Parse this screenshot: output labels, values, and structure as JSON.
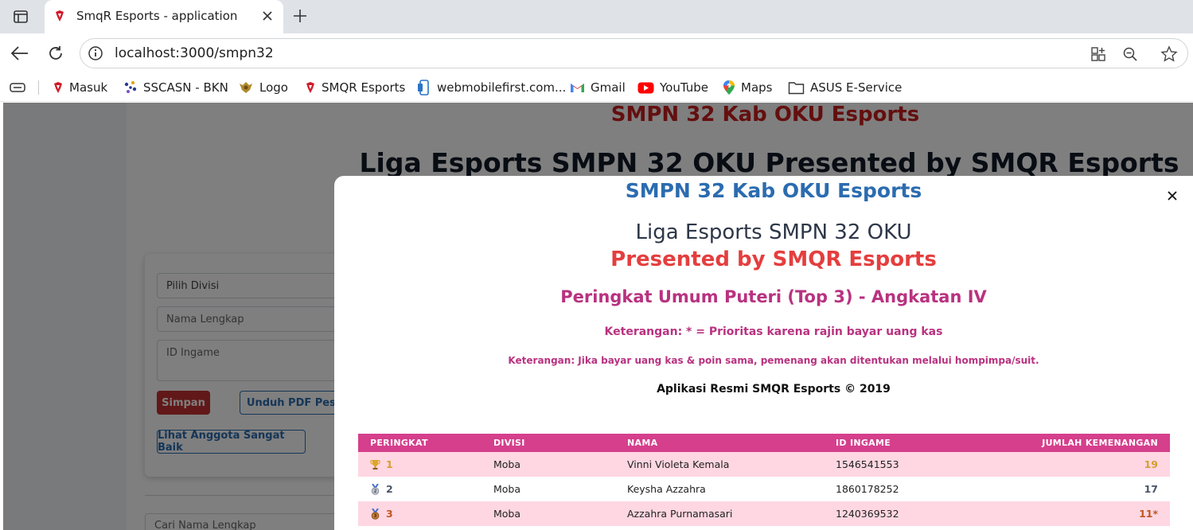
{
  "browser": {
    "tab_title": "SmqR Esports - application",
    "url": "localhost:3000/smpn32",
    "bookmarks": [
      {
        "label": "Masuk",
        "icon": "smqr-logo-icon"
      },
      {
        "label": "SSCASN - BKN",
        "icon": "sscasn-icon"
      },
      {
        "label": "Logo",
        "icon": "emblem-icon"
      },
      {
        "label": "SMQR Esports",
        "icon": "smqr-logo-icon"
      },
      {
        "label": "webmobilefirst.com...",
        "icon": "phone-icon"
      },
      {
        "label": "Gmail",
        "icon": "gmail-icon"
      },
      {
        "label": "YouTube",
        "icon": "youtube-icon"
      },
      {
        "label": "Maps",
        "icon": "maps-pin-icon"
      },
      {
        "label": "ASUS E-Service",
        "icon": "folder-icon"
      }
    ]
  },
  "background_page": {
    "title": "SMPN 32 Kab OKU Esports",
    "subtitle": "Liga Esports SMPN 32 OKU Presented by SMQR Esports",
    "form": {
      "division_placeholder": "Pilih Divisi",
      "name_placeholder": "Nama Lengkap",
      "ingame_placeholder": "ID Ingame",
      "save_label": "Simpan",
      "download_label": "Unduh PDF Peserta",
      "members_label": "Lihat Anggota Sangat Baik"
    },
    "search_placeholder": "Cari Nama Lengkap"
  },
  "modal": {
    "title": "SMPN 32 Kab OKU Esports",
    "league": "Liga Esports SMPN 32 OKU",
    "presented": "Presented by SMQR Esports",
    "ranking_title": "Peringkat Umum Puteri (Top 3) - Angkatan IV",
    "note_priority": "Keterangan: * = Prioritas karena rajin bayar uang kas",
    "note_tie": "Keterangan: Jika bayar uang kas & poin sama, pemenang akan ditentukan melalui hompimpa/suit.",
    "copyright": "Aplikasi Resmi SMQR Esports © 2019",
    "table": {
      "headers": [
        "PERINGKAT",
        "DIVISI",
        "NAMA",
        "ID INGAME",
        "JUMLAH KEMENANGAN"
      ],
      "rows": [
        {
          "rank": "1",
          "medal": "trophy-icon",
          "division": "Moba",
          "name": "Vinni Violeta Kemala",
          "ingame_id": "1546541553",
          "wins": "19",
          "color": "#d69e2e"
        },
        {
          "rank": "2",
          "medal": "silver-medal-icon",
          "division": "Moba",
          "name": "Keysha Azzahra",
          "ingame_id": "1860178252",
          "wins": "17",
          "color": "#4a5568"
        },
        {
          "rank": "3",
          "medal": "bronze-medal-icon",
          "division": "Moba",
          "name": "Azzahra Purnamasari",
          "ingame_id": "1240369532",
          "wins": "11*",
          "color": "#c05621"
        }
      ]
    }
  },
  "colors": {
    "modal_title": "#2b6cb0",
    "presented": "#e53e3e",
    "accent_pink": "#d53f8c",
    "row_pink": "#fed7e2"
  }
}
